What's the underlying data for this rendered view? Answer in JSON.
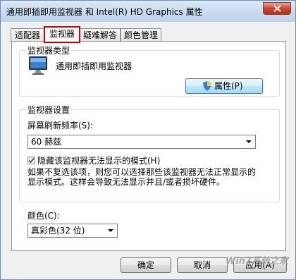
{
  "window": {
    "title": "通用即插即用监视器 和 Intel(R) HD Graphics 属性"
  },
  "tabs": [
    {
      "label": "适配器"
    },
    {
      "label": "监视器",
      "active": true
    },
    {
      "label": "疑难解答"
    },
    {
      "label": "颜色管理"
    }
  ],
  "monitor_type": {
    "group_title": "监视器类型",
    "name": "通用即插即用监视器",
    "properties_button": "属性(P)"
  },
  "monitor_settings": {
    "group_title": "监视器设置",
    "refresh_label": "屏幕刷新频率(S):",
    "refresh_value": "60 赫兹",
    "hide_modes_label": "隐藏该监视器无法显示的模式(H)",
    "hide_modes_checked": true,
    "description_line1": "如果不复选该项，则您可以选择那些该监视器无法正常显示的",
    "description_line2": "显示模式。这样会导致无法显示并且/或者损坏硬件。"
  },
  "colors": {
    "label": "颜色(C):",
    "value": "真彩色(32 位)"
  },
  "footer": {
    "ok_button": "确定",
    "cancel_button": "取消",
    "apply_button": "应用(A)"
  },
  "watermark": "Win7系统之家",
  "accent_colors": {
    "active_tab_highlight": "#d40000",
    "titlebar": "#c8daef"
  },
  "icons": [
    "close-icon",
    "monitor-icon",
    "shield-icon",
    "checkmark-icon",
    "chevron-down-icon"
  ]
}
